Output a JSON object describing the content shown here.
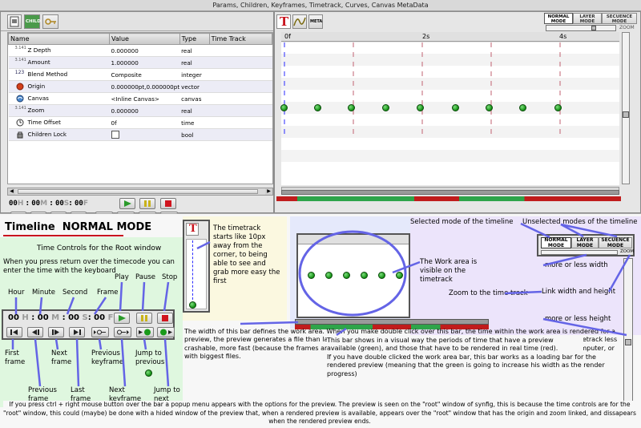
{
  "window": {
    "title": "Params, Children, Keyframes, Timetrack, Curves, Canvas MetaData"
  },
  "left_panel": {
    "tabs": [
      {
        "icon": "params-tab-icon"
      },
      {
        "icon": "children-tab-icon",
        "label": "CHILD"
      },
      {
        "icon": "keyframes-tab-icon"
      }
    ],
    "columns": [
      "Name",
      "Value",
      "Type",
      "Time Track"
    ],
    "rows": [
      {
        "icon": "3.141",
        "name": "Z Depth",
        "value": "0.000000",
        "type": "real"
      },
      {
        "icon": "3.141",
        "name": "Amount",
        "value": "1.000000",
        "type": "real"
      },
      {
        "icon": "123",
        "name": "Blend Method",
        "value": "Composite",
        "type": "integer"
      },
      {
        "icon": "origin",
        "name": "Origin",
        "value": "0.000000pt,0.000000pt",
        "type": "vector"
      },
      {
        "icon": "canvas",
        "name": "Canvas",
        "value": "<Inline Canvas>",
        "type": "canvas"
      },
      {
        "icon": "3.141",
        "name": "Zoom",
        "value": "0.000000",
        "type": "real"
      },
      {
        "icon": "clock",
        "name": "Time Offset",
        "value": "0f",
        "type": "time"
      },
      {
        "icon": "lock",
        "name": "Children Lock",
        "value": "",
        "type": "bool"
      }
    ],
    "timecode": {
      "h": "00",
      "hl": "H",
      "m": "00",
      "ml": "M",
      "s": "00",
      "sl": "S",
      "f": "00",
      "fl": "F"
    }
  },
  "right_panel": {
    "tabs": [
      {
        "icon": "timetrack-tab-icon",
        "label": "T"
      },
      {
        "icon": "curves-tab-icon"
      },
      {
        "icon": "meta-tab-icon",
        "label": "META"
      }
    ],
    "modes": [
      {
        "line1": "NORMAL",
        "line2": "MODE",
        "selected": true
      },
      {
        "line1": "LAYER",
        "line2": "MODE",
        "selected": false
      },
      {
        "line1": "SECUENCE",
        "line2": "MODE",
        "selected": false
      }
    ],
    "zoom_label": "ZOOM",
    "ruler": [
      "0f",
      "2s",
      "4s"
    ]
  },
  "tutorial": {
    "heading_prefix": "Timeline",
    "heading_mode": "NORMAL MODE",
    "time_controls_title": "Time Controls for the Root window",
    "time_controls_desc": "When you press return over the timecode you can enter the time with the keyboard",
    "labels": {
      "hour": "Hour",
      "minute": "Minute",
      "second": "Second",
      "frame": "Frame",
      "play": "Play",
      "pause": "Pause",
      "stop": "Stop",
      "first_frame": "First frame",
      "previous_frame": "Previous frame",
      "next_frame": "Next frame",
      "last_frame": "Last frame",
      "previous_keyframe": "Previous keyframe",
      "next_keyframe": "Next keyframe",
      "jump_previous": "Jump to previous",
      "jump_next": "Jump to next"
    },
    "timetrack_note": "The timetrack starts like 10px away from the corner, to being able to see and grab more easy the first",
    "work_area_note": "The Work area is visible on the timetrack",
    "selected_mode": "Selected mode of the timeline",
    "unselected_modes": "Unselected modes of the timeline",
    "more_less_width": "more or less width",
    "link_width_height": "Link width and height",
    "zoom_timetrack": "Zoom to the time track",
    "more_less_height": "more or less height",
    "work_bar_note": "The width of this bar defines the work area. When you make double click over this bar, the time within the work area is rendered for a preview, the preview generates a file than later synfig can read as video (or list of images), making the travel throw the timetrack less crashable, more fast (because the frames are already rendered), and with this method is more easy to work from a slow computer, or with biggest files.",
    "preview_bar_note": "This bar shows in a visual way the periods of time that have a preview available (green), and those that have to be rendered in real time (red).",
    "loading_bar_note": "If you have double clicked the work area bar, this bar works as a loading bar for the rendered preview (meaning that the green is going to increase his width as the render progress)",
    "bottom_note": "If you press ctrl + right mouse button over the bar a popup menu appears with the options for the preview. The preview is seen on the \"root\" window of synfig, this is because the time controls are for the \"root\" window, this could (maybe) be done with a hided window of the preview that, when a rendered preview is available, appears over the \"root\" window that has the origin and zoom linked, and dissapears when the rendered preview ends."
  },
  "colors": {
    "accent_red": "#c8141e",
    "keyframe_green": "#1a9a1a",
    "preview_red": "#c01c1c",
    "preview_green": "#2ea44a",
    "note_blue": "#5a5ae0",
    "note_bg_green": "#dff7df",
    "note_bg_yellow": "#fbf8e0",
    "note_bg_lilac": "#ece4fb"
  }
}
